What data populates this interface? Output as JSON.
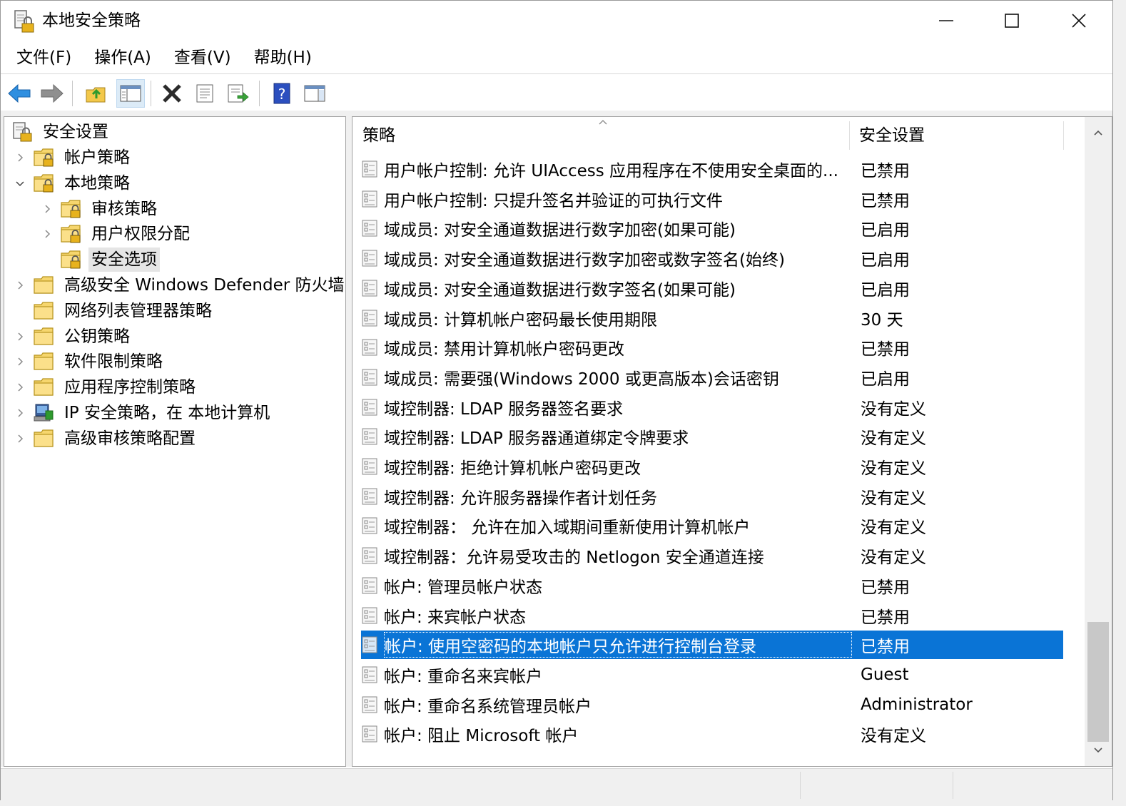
{
  "window": {
    "title": "本地安全策略"
  },
  "menu": [
    "文件(F)",
    "操作(A)",
    "查看(V)",
    "帮助(H)"
  ],
  "toolbar": {
    "icons": [
      "back-arrow-icon",
      "forward-arrow-icon",
      "up-folder-icon",
      "show-hide-tree-icon",
      "delete-icon",
      "properties-icon",
      "export-list-icon",
      "help-icon",
      "columns-icon"
    ],
    "active": "show-hide-tree-icon"
  },
  "tree": {
    "root": "安全设置",
    "items": [
      {
        "label": "帐户策略",
        "indent": 1,
        "expander": "collapsed",
        "icon": "folder-lock"
      },
      {
        "label": "本地策略",
        "indent": 1,
        "expander": "expanded",
        "icon": "folder-lock"
      },
      {
        "label": "审核策略",
        "indent": 2,
        "expander": "collapsed",
        "icon": "folder-lock"
      },
      {
        "label": "用户权限分配",
        "indent": 2,
        "expander": "collapsed",
        "icon": "folder-lock"
      },
      {
        "label": "安全选项",
        "indent": 2,
        "expander": "none",
        "icon": "folder-lock",
        "selected": true
      },
      {
        "label": "高级安全 Windows Defender 防火墙",
        "indent": 1,
        "expander": "collapsed",
        "icon": "folder"
      },
      {
        "label": "网络列表管理器策略",
        "indent": 1,
        "expander": "none",
        "icon": "folder"
      },
      {
        "label": "公钥策略",
        "indent": 1,
        "expander": "collapsed",
        "icon": "folder"
      },
      {
        "label": "软件限制策略",
        "indent": 1,
        "expander": "collapsed",
        "icon": "folder"
      },
      {
        "label": "应用程序控制策略",
        "indent": 1,
        "expander": "collapsed",
        "icon": "folder"
      },
      {
        "label": "IP 安全策略，在 本地计算机",
        "indent": 1,
        "expander": "collapsed",
        "icon": "ip-security"
      },
      {
        "label": "高级审核策略配置",
        "indent": 1,
        "expander": "collapsed",
        "icon": "folder"
      }
    ]
  },
  "list": {
    "columns": {
      "policy": "策略",
      "setting": "安全设置"
    },
    "rows": [
      {
        "policy": "用户帐户控制: 允许 UIAccess 应用程序在不使用安全桌面的...",
        "setting": "已禁用"
      },
      {
        "policy": "用户帐户控制: 只提升签名并验证的可执行文件",
        "setting": "已禁用"
      },
      {
        "policy": "域成员: 对安全通道数据进行数字加密(如果可能)",
        "setting": "已启用"
      },
      {
        "policy": "域成员: 对安全通道数据进行数字加密或数字签名(始终)",
        "setting": "已启用"
      },
      {
        "policy": "域成员: 对安全通道数据进行数字签名(如果可能)",
        "setting": "已启用"
      },
      {
        "policy": "域成员: 计算机帐户密码最长使用期限",
        "setting": "30 天"
      },
      {
        "policy": "域成员: 禁用计算机帐户密码更改",
        "setting": "已禁用"
      },
      {
        "policy": "域成员: 需要强(Windows 2000 或更高版本)会话密钥",
        "setting": "已启用"
      },
      {
        "policy": "域控制器: LDAP 服务器签名要求",
        "setting": "没有定义"
      },
      {
        "policy": "域控制器: LDAP 服务器通道绑定令牌要求",
        "setting": "没有定义"
      },
      {
        "policy": "域控制器: 拒绝计算机帐户密码更改",
        "setting": "没有定义"
      },
      {
        "policy": "域控制器: 允许服务器操作者计划任务",
        "setting": "没有定义"
      },
      {
        "policy": "域控制器：  允许在加入域期间重新使用计算机帐户",
        "setting": "没有定义"
      },
      {
        "policy": "域控制器：允许易受攻击的 Netlogon 安全通道连接",
        "setting": "没有定义"
      },
      {
        "policy": "帐户: 管理员帐户状态",
        "setting": "已禁用"
      },
      {
        "policy": "帐户: 来宾帐户状态",
        "setting": "已禁用"
      },
      {
        "policy": "帐户: 使用空密码的本地帐户只允许进行控制台登录",
        "setting": "已禁用",
        "selected": true
      },
      {
        "policy": "帐户: 重命名来宾帐户",
        "setting": "Guest"
      },
      {
        "policy": "帐户: 重命名系统管理员帐户",
        "setting": "Administrator"
      },
      {
        "policy": "帐户: 阻止 Microsoft 帐户",
        "setting": "没有定义"
      }
    ]
  },
  "colors": {
    "selection": "#0a74d6",
    "accent": "#1a73d6"
  }
}
